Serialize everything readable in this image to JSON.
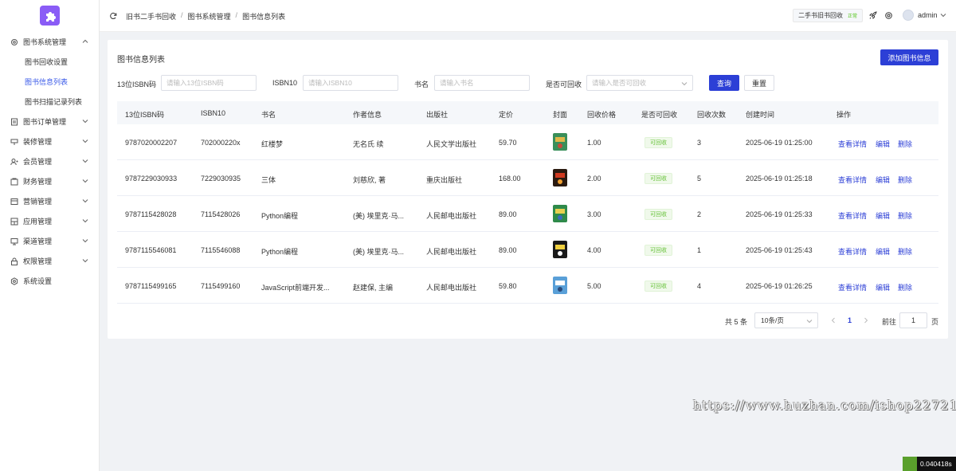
{
  "sidebar": {
    "items": [
      {
        "label": "图书系统管理",
        "icon": "gear-icon",
        "expanded": true,
        "children": [
          {
            "label": "图书回收设置",
            "active": false
          },
          {
            "label": "图书信息列表",
            "active": true
          },
          {
            "label": "图书扫描记录列表",
            "active": false
          }
        ]
      },
      {
        "label": "图书订单管理",
        "icon": "document-icon"
      },
      {
        "label": "装修管理",
        "icon": "brush-icon"
      },
      {
        "label": "会员管理",
        "icon": "user-icon"
      },
      {
        "label": "财务管理",
        "icon": "wallet-icon"
      },
      {
        "label": "营销管理",
        "icon": "ticket-icon"
      },
      {
        "label": "应用管理",
        "icon": "apps-icon"
      },
      {
        "label": "渠道管理",
        "icon": "monitor-icon"
      },
      {
        "label": "权限管理",
        "icon": "lock-icon"
      },
      {
        "label": "系统设置",
        "icon": "settings-icon"
      }
    ]
  },
  "header": {
    "breadcrumb": [
      "旧书二手书回收",
      "图书系统管理",
      "图书信息列表"
    ],
    "shop_name": "二手书旧书回收",
    "shop_status": "正常",
    "username": "admin"
  },
  "page": {
    "title": "图书信息列表",
    "add_button": "添加图书信息"
  },
  "filters": {
    "isbn13_label": "13位ISBN码",
    "isbn13_placeholder": "请输入13位ISBN码",
    "isbn10_label": "ISBN10",
    "isbn10_placeholder": "请输入ISBN10",
    "title_label": "书名",
    "title_placeholder": "请输入书名",
    "recyclable_label": "是否可回收",
    "recyclable_placeholder": "请输入是否可回收",
    "query_button": "查询",
    "reset_button": "重置"
  },
  "table": {
    "columns": [
      "13位ISBN码",
      "ISBN10",
      "书名",
      "作者信息",
      "出版社",
      "定价",
      "封面",
      "回收价格",
      "是否可回收",
      "回收次数",
      "创建时间",
      "操作"
    ],
    "rows": [
      {
        "isbn13": "9787020002207",
        "isbn10": "702000220x",
        "title": "红楼梦",
        "author": "无名氏 续",
        "publisher": "人民文学出版社",
        "price": "59.70",
        "cover": "cover-book-1",
        "recycle_price": "1.00",
        "recyclable": "可回收",
        "count": "3",
        "created": "2025-06-19 01:25:00"
      },
      {
        "isbn13": "9787229030933",
        "isbn10": "7229030935",
        "title": "三体",
        "author": "刘慈欣, 著",
        "publisher": "重庆出版社",
        "price": "168.00",
        "cover": "cover-book-2",
        "recycle_price": "2.00",
        "recyclable": "可回收",
        "count": "5",
        "created": "2025-06-19 01:25:18"
      },
      {
        "isbn13": "9787115428028",
        "isbn10": "7115428026",
        "title": "Python编程",
        "author": "(美) 埃里克·马...",
        "publisher": "人民邮电出版社",
        "price": "89.00",
        "cover": "cover-book-3",
        "recycle_price": "3.00",
        "recyclable": "可回收",
        "count": "2",
        "created": "2025-06-19 01:25:33"
      },
      {
        "isbn13": "9787115546081",
        "isbn10": "7115546088",
        "title": "Python编程",
        "author": "(美) 埃里克·马...",
        "publisher": "人民邮电出版社",
        "price": "89.00",
        "cover": "cover-book-4",
        "recycle_price": "4.00",
        "recyclable": "可回收",
        "count": "1",
        "created": "2025-06-19 01:25:43"
      },
      {
        "isbn13": "9787115499165",
        "isbn10": "7115499160",
        "title": "JavaScript前端开发...",
        "author": "赵建保, 主编",
        "publisher": "人民邮电出版社",
        "price": "59.80",
        "cover": "cover-book-5",
        "recycle_price": "5.00",
        "recyclable": "可回收",
        "count": "4",
        "created": "2025-06-19 01:26:25"
      }
    ],
    "actions": [
      "查看详情",
      "编辑",
      "删除"
    ]
  },
  "pagination": {
    "total": "共 5 条",
    "page_size": "10条/页",
    "current": "1",
    "goto_label": "前往",
    "goto_value": "1",
    "page_suffix": "页"
  },
  "watermark": "https://www.huzhan.com/ishop22721",
  "timer": "0.040418s",
  "colors": {
    "primary": "#2c3fd6",
    "logo": "#8a5cf6",
    "success": "#67c23a"
  }
}
